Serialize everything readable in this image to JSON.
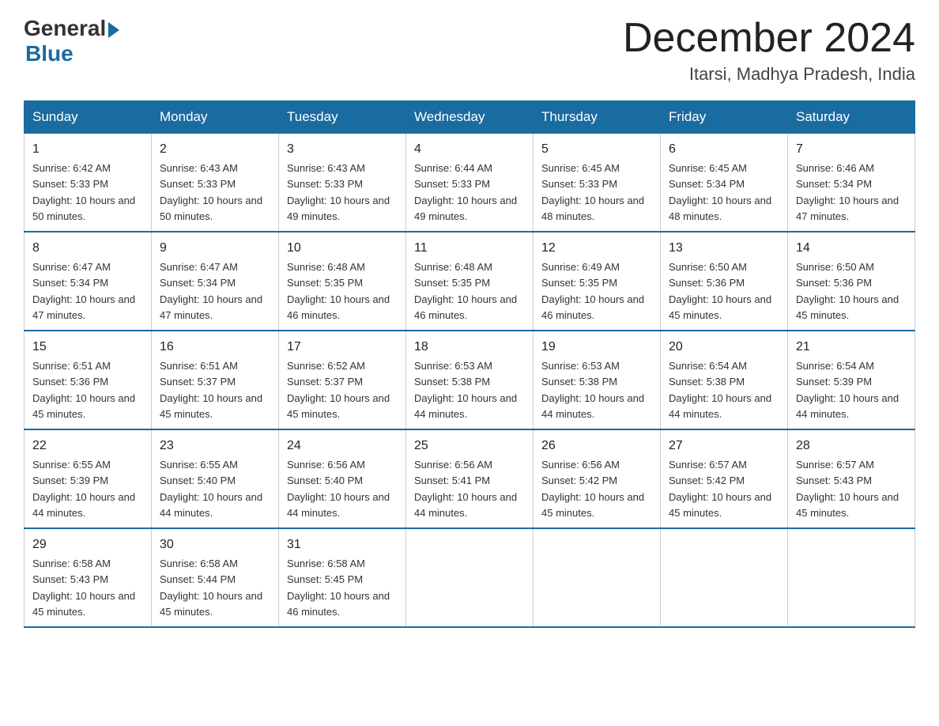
{
  "header": {
    "logo_general": "General",
    "logo_blue": "Blue",
    "month_year": "December 2024",
    "location": "Itarsi, Madhya Pradesh, India"
  },
  "days_of_week": [
    "Sunday",
    "Monday",
    "Tuesday",
    "Wednesday",
    "Thursday",
    "Friday",
    "Saturday"
  ],
  "weeks": [
    [
      {
        "day": "1",
        "sunrise": "6:42 AM",
        "sunset": "5:33 PM",
        "daylight": "10 hours and 50 minutes."
      },
      {
        "day": "2",
        "sunrise": "6:43 AM",
        "sunset": "5:33 PM",
        "daylight": "10 hours and 50 minutes."
      },
      {
        "day": "3",
        "sunrise": "6:43 AM",
        "sunset": "5:33 PM",
        "daylight": "10 hours and 49 minutes."
      },
      {
        "day": "4",
        "sunrise": "6:44 AM",
        "sunset": "5:33 PM",
        "daylight": "10 hours and 49 minutes."
      },
      {
        "day": "5",
        "sunrise": "6:45 AM",
        "sunset": "5:33 PM",
        "daylight": "10 hours and 48 minutes."
      },
      {
        "day": "6",
        "sunrise": "6:45 AM",
        "sunset": "5:34 PM",
        "daylight": "10 hours and 48 minutes."
      },
      {
        "day": "7",
        "sunrise": "6:46 AM",
        "sunset": "5:34 PM",
        "daylight": "10 hours and 47 minutes."
      }
    ],
    [
      {
        "day": "8",
        "sunrise": "6:47 AM",
        "sunset": "5:34 PM",
        "daylight": "10 hours and 47 minutes."
      },
      {
        "day": "9",
        "sunrise": "6:47 AM",
        "sunset": "5:34 PM",
        "daylight": "10 hours and 47 minutes."
      },
      {
        "day": "10",
        "sunrise": "6:48 AM",
        "sunset": "5:35 PM",
        "daylight": "10 hours and 46 minutes."
      },
      {
        "day": "11",
        "sunrise": "6:48 AM",
        "sunset": "5:35 PM",
        "daylight": "10 hours and 46 minutes."
      },
      {
        "day": "12",
        "sunrise": "6:49 AM",
        "sunset": "5:35 PM",
        "daylight": "10 hours and 46 minutes."
      },
      {
        "day": "13",
        "sunrise": "6:50 AM",
        "sunset": "5:36 PM",
        "daylight": "10 hours and 45 minutes."
      },
      {
        "day": "14",
        "sunrise": "6:50 AM",
        "sunset": "5:36 PM",
        "daylight": "10 hours and 45 minutes."
      }
    ],
    [
      {
        "day": "15",
        "sunrise": "6:51 AM",
        "sunset": "5:36 PM",
        "daylight": "10 hours and 45 minutes."
      },
      {
        "day": "16",
        "sunrise": "6:51 AM",
        "sunset": "5:37 PM",
        "daylight": "10 hours and 45 minutes."
      },
      {
        "day": "17",
        "sunrise": "6:52 AM",
        "sunset": "5:37 PM",
        "daylight": "10 hours and 45 minutes."
      },
      {
        "day": "18",
        "sunrise": "6:53 AM",
        "sunset": "5:38 PM",
        "daylight": "10 hours and 44 minutes."
      },
      {
        "day": "19",
        "sunrise": "6:53 AM",
        "sunset": "5:38 PM",
        "daylight": "10 hours and 44 minutes."
      },
      {
        "day": "20",
        "sunrise": "6:54 AM",
        "sunset": "5:38 PM",
        "daylight": "10 hours and 44 minutes."
      },
      {
        "day": "21",
        "sunrise": "6:54 AM",
        "sunset": "5:39 PM",
        "daylight": "10 hours and 44 minutes."
      }
    ],
    [
      {
        "day": "22",
        "sunrise": "6:55 AM",
        "sunset": "5:39 PM",
        "daylight": "10 hours and 44 minutes."
      },
      {
        "day": "23",
        "sunrise": "6:55 AM",
        "sunset": "5:40 PM",
        "daylight": "10 hours and 44 minutes."
      },
      {
        "day": "24",
        "sunrise": "6:56 AM",
        "sunset": "5:40 PM",
        "daylight": "10 hours and 44 minutes."
      },
      {
        "day": "25",
        "sunrise": "6:56 AM",
        "sunset": "5:41 PM",
        "daylight": "10 hours and 44 minutes."
      },
      {
        "day": "26",
        "sunrise": "6:56 AM",
        "sunset": "5:42 PM",
        "daylight": "10 hours and 45 minutes."
      },
      {
        "day": "27",
        "sunrise": "6:57 AM",
        "sunset": "5:42 PM",
        "daylight": "10 hours and 45 minutes."
      },
      {
        "day": "28",
        "sunrise": "6:57 AM",
        "sunset": "5:43 PM",
        "daylight": "10 hours and 45 minutes."
      }
    ],
    [
      {
        "day": "29",
        "sunrise": "6:58 AM",
        "sunset": "5:43 PM",
        "daylight": "10 hours and 45 minutes."
      },
      {
        "day": "30",
        "sunrise": "6:58 AM",
        "sunset": "5:44 PM",
        "daylight": "10 hours and 45 minutes."
      },
      {
        "day": "31",
        "sunrise": "6:58 AM",
        "sunset": "5:45 PM",
        "daylight": "10 hours and 46 minutes."
      },
      null,
      null,
      null,
      null
    ]
  ]
}
